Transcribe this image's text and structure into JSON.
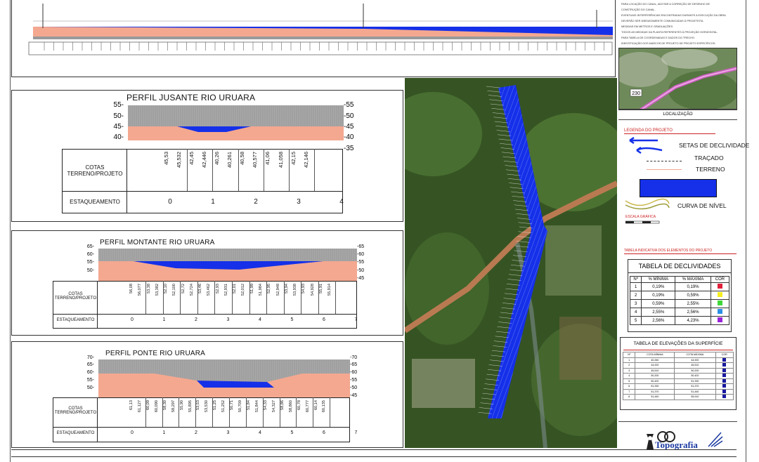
{
  "top_notes": [
    "PARA LOCAÇÃO DO CANAL, ADOTAR A CORREÇÃO DE DESENHO DE",
    "CONSTRUÇÃO DO CANAL.",
    "EVENTUAIS INTERFERÊNCIAS ENCONTRADAS DURANTE A EXECUÇÃO DA OBRA",
    "DEVERÃO SER IMEDIATAMENTE COMUNICADAS À PROJETISTA.",
    "MEDIDAS EM METROS E GRADUAÇÕES.",
    "TODOS AS MEDIDAS DA PLANTA REFERENTES À PROJEÇÃO HORIZONTAL.",
    "PARA TABELA DE COORDENADAS E DADOS DO TRECHO.",
    "IDENTIFICAÇÃO DOS MARCOS DE PROJETO DE PROJETO ESPECÍFICOS."
  ],
  "profiles": [
    {
      "title": "PERFIL JUSANTE RIO URUARA",
      "y_ticks": [
        "55",
        "50",
        "45",
        "40"
      ],
      "y_ticks_right": [
        "55",
        "50",
        "45",
        "40",
        "35"
      ],
      "row_cotas": "COTAS TERRENO/PROJETO",
      "row_estaq": "ESTAQUEAMENTO",
      "cotas": [
        "45,53",
        "45,532",
        "42,45",
        "42,446",
        "40,26",
        "40,261",
        "40,58",
        "40,577",
        "41,06",
        "41,058",
        "42,15",
        "42,146"
      ],
      "estaq": [
        "0",
        "1",
        "2",
        "3",
        "4"
      ]
    },
    {
      "title": "PERFIL MONTANTE RIO URUARA",
      "y_ticks": [
        "65",
        "60",
        "55",
        "50"
      ],
      "y_ticks_right": [
        "65",
        "60",
        "55",
        "50",
        "45"
      ],
      "row_cotas": "COTAS TERRENO/PROJETO",
      "row_estaq": "ESTAQUEAMENTO",
      "cotas": [
        "56,08",
        "56,077",
        "53,38",
        "53,382",
        "52,10",
        "52,100",
        "52,72",
        "52,724",
        "53,46",
        "53,462",
        "52,93",
        "52,931",
        "52,01",
        "52,012",
        "51,99",
        "51,984",
        "52,95",
        "52,948",
        "53,94",
        "53,938",
        "54,93",
        "54,928",
        "55,91",
        "55,914"
      ],
      "estaq": [
        "0",
        "1",
        "2",
        "3",
        "4",
        "5",
        "6",
        "7"
      ]
    },
    {
      "title": "PERFIL PONTE RIO URUARA",
      "y_ticks": [
        "70",
        "65",
        "60",
        "55",
        "50"
      ],
      "y_ticks_right": [
        "70",
        "65",
        "60",
        "55",
        "50",
        "45"
      ],
      "row_cotas": "COTAS TERRENO/PROJETO",
      "row_estaq": "ESTAQUEAMENTO",
      "cotas": [
        "61,13",
        "61,127",
        "60,09",
        "60,090",
        "58,30",
        "58,297",
        "55,90",
        "55,895",
        "53,53",
        "53,530",
        "51,25",
        "51,252",
        "50,71",
        "50,709",
        "51,84",
        "51,844",
        "54,33",
        "54,327",
        "58,86",
        "58,860",
        "60,78",
        "60,777",
        "60,14",
        "60,135"
      ],
      "estaq": [
        "0",
        "1",
        "2",
        "3",
        "4",
        "5",
        "6",
        "7"
      ]
    }
  ],
  "location_caption": "LOCALIZAÇÃO",
  "map_road_label": "230",
  "legend": {
    "heading": "LEGENDA DO PROJETO",
    "items": [
      "SETAS DE DECLIVIDADE",
      "TRAÇADO",
      "TERRENO",
      "CURVA DE NÍVEL"
    ],
    "escala": "ESCALA GRÁFICA"
  },
  "decl_heading": "TABELA INDICATIVA DOS ELEMENTOS DO PROJETO",
  "decl_table": {
    "title": "TABELA DE DECLIVIDADES",
    "headers": [
      "Nº",
      "% MÍNIMA",
      "% MÁXIMA",
      "COR"
    ],
    "rows": [
      {
        "n": "1",
        "min": "0,19%",
        "max": "0,19%",
        "color": "#e0203a"
      },
      {
        "n": "2",
        "min": "0,19%",
        "max": "0,59%",
        "color": "#f4ee22"
      },
      {
        "n": "3",
        "min": "0,59%",
        "max": "2,55%",
        "color": "#3fd63a"
      },
      {
        "n": "4",
        "min": "2,55%",
        "max": "2,56%",
        "color": "#2a8fe6"
      },
      {
        "n": "5",
        "min": "2,56%",
        "max": "4,23%",
        "color": "#9a22d8"
      }
    ]
  },
  "elev_table": {
    "title": "TABELA DE ELEVAÇÕES DA SUPERFÍCIE",
    "headers": [
      "Nº",
      "COTA MÍNIMA",
      "COTA MÁXIMA",
      "COR"
    ],
    "rows": [
      {
        "n": "1",
        "min": "40,260",
        "max": "44,920"
      },
      {
        "n": "2",
        "min": "44,920",
        "max": "45,510"
      },
      {
        "n": "3",
        "min": "45,510",
        "max": "50,200"
      },
      {
        "n": "4",
        "min": "50,200",
        "max": "50,420"
      },
      {
        "n": "5",
        "min": "50,420",
        "max": "51,330"
      },
      {
        "n": "6",
        "min": "51,330",
        "max": "51,370"
      },
      {
        "n": "7",
        "min": "51,370",
        "max": "51,440"
      },
      {
        "n": "8",
        "min": "51,440",
        "max": "55,910"
      }
    ]
  },
  "company": "Topografia",
  "colors": {
    "water": "#1530e8",
    "terrain": "#f4a890",
    "sky": "#9a9a9a"
  }
}
